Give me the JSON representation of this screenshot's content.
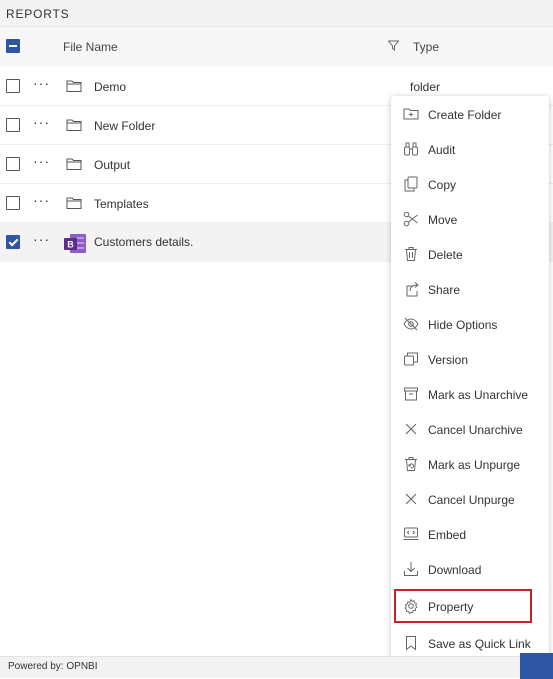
{
  "header": {
    "title": "REPORTS"
  },
  "columns": {
    "file_name": "File Name",
    "type": "Type"
  },
  "rows": [
    {
      "name": "Demo",
      "type": "folder",
      "icon": "folder-icon",
      "checked": false
    },
    {
      "name": "New Folder",
      "type": "",
      "icon": "folder-icon",
      "checked": false
    },
    {
      "name": "Output",
      "type": "",
      "icon": "folder-icon",
      "checked": false
    },
    {
      "name": "Templates",
      "type": "",
      "icon": "folder-icon",
      "checked": false
    },
    {
      "name": "Customers details.",
      "type": "",
      "icon": "report-file-icon",
      "checked": true
    }
  ],
  "row_menu_label": "···",
  "context_menu": {
    "items": [
      {
        "label": "Create Folder",
        "icon": "create-folder-icon"
      },
      {
        "label": "Audit",
        "icon": "binoculars-icon"
      },
      {
        "label": "Copy",
        "icon": "copy-icon"
      },
      {
        "label": "Move",
        "icon": "scissors-icon"
      },
      {
        "label": "Delete",
        "icon": "trash-icon"
      },
      {
        "label": "Share",
        "icon": "share-icon"
      },
      {
        "label": "Hide Options",
        "icon": "eye-slash-icon"
      },
      {
        "label": "Version",
        "icon": "version-icon"
      },
      {
        "label": "Mark as Unarchive",
        "icon": "archive-icon"
      },
      {
        "label": "Cancel Unarchive",
        "icon": "close-icon"
      },
      {
        "label": "Mark as Unpurge",
        "icon": "unpurge-icon"
      },
      {
        "label": "Cancel Unpurge",
        "icon": "close-icon"
      },
      {
        "label": "Embed",
        "icon": "embed-icon"
      },
      {
        "label": "Download",
        "icon": "download-icon"
      },
      {
        "label": "Property",
        "icon": "gear-icon",
        "highlighted": true
      },
      {
        "label": "Save as Quick Link",
        "icon": "bookmark-icon"
      }
    ]
  },
  "footer": {
    "powered_by": "Powered by: OPNBI"
  },
  "colors": {
    "accent": "#2f55a5",
    "highlight_border": "#c0272d",
    "report_icon": "#5b2d91"
  }
}
